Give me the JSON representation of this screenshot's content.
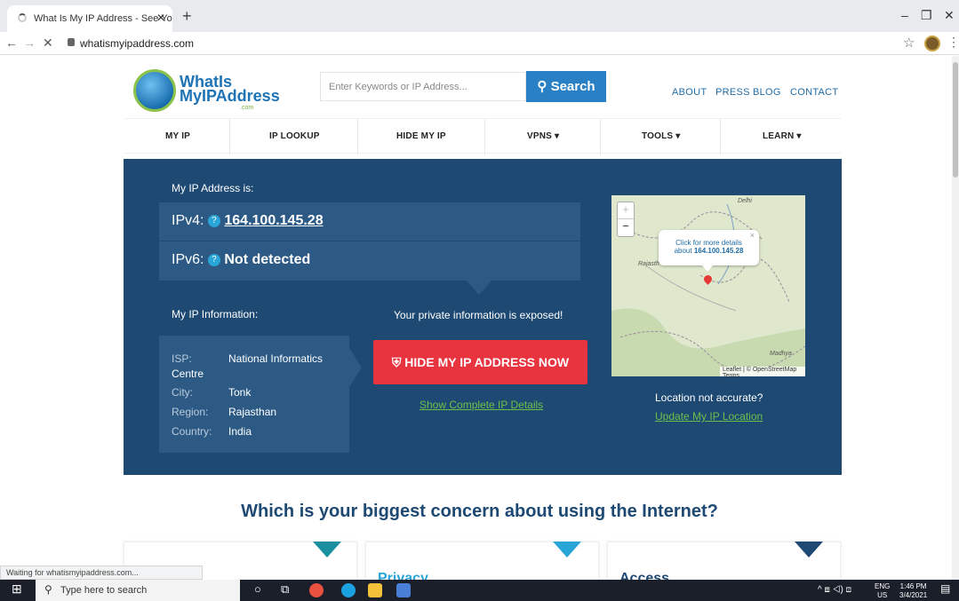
{
  "browser": {
    "tab_title": "What Is My IP Address - See Your",
    "url": "whatismyipaddress.com",
    "status": "Waiting for whatismyipaddress.com..."
  },
  "site": {
    "logo": {
      "line1": "WhatIs",
      "line2": "MyIPAddress",
      "line3": ".com"
    },
    "search": {
      "placeholder": "Enter Keywords or IP Address...",
      "button": "Search"
    },
    "top_links": [
      "ABOUT",
      "PRESS",
      "BLOG",
      "CONTACT"
    ],
    "menu": [
      "MY IP",
      "IP LOOKUP",
      "HIDE MY IP",
      "VPNS ▾",
      "TOOLS ▾",
      "LEARN ▾"
    ]
  },
  "hero": {
    "my_ip_label": "My IP Address is:",
    "ipv4_label": "IPv4:",
    "ipv4_value": "164.100.145.28",
    "ipv6_label": "IPv6:",
    "ipv6_value": "Not detected",
    "info_label": "My IP Information:",
    "isp_label": "ISP:",
    "isp_value": "National Informatics",
    "isp_value2": "Centre",
    "city_label": "City:",
    "city_value": "Tonk",
    "region_label": "Region:",
    "region_value": "Rajasthan",
    "country_label": "Country:",
    "country_value": "India",
    "exposed": "Your private information is exposed!",
    "hide_button": "HIDE MY IP ADDRESS NOW",
    "complete_details": "Show Complete IP Details",
    "location_question": "Location not accurate?",
    "update_location": "Update My IP Location",
    "map": {
      "popup_line1": "Click for more details",
      "popup_line2_prefix": "about ",
      "popup_ip": "164.100.145.28",
      "label_delhi": "Delhi",
      "label_rajasthan": "Rajasth",
      "label_madhya": "Madhya",
      "attribution": "Leaflet | © OpenStreetMap Terms"
    }
  },
  "concern": {
    "heading": "Which is your biggest concern about using the Internet?",
    "cards": [
      "",
      "Privacy",
      "Access"
    ]
  },
  "taskbar": {
    "search_placeholder": "Type here to search",
    "lang": "ENG",
    "region": "US",
    "time": "1:46 PM",
    "date": "3/4/2021"
  }
}
